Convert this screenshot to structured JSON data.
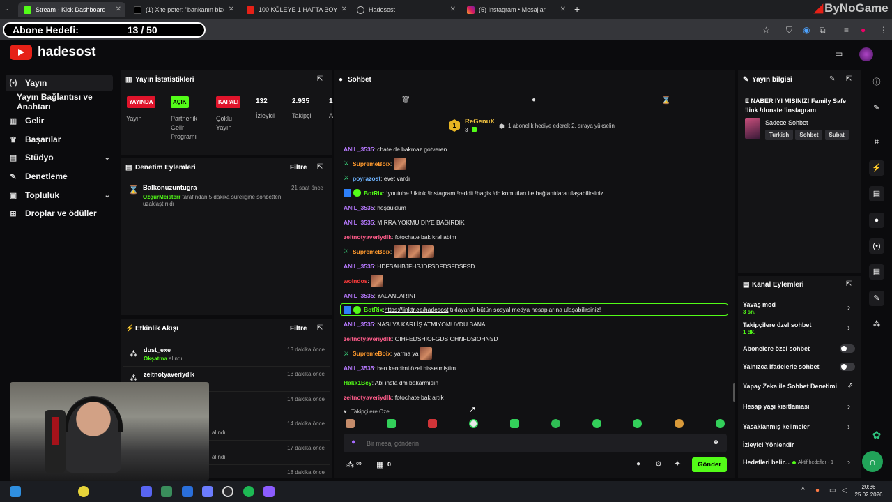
{
  "browser": {
    "tabs": [
      {
        "label": "Stream - Kick Dashboard",
        "active": true
      },
      {
        "label": "(1) X'te peter: \"bankanın bize 5("
      },
      {
        "label": "100 KÖLEYE 1 HAFTA BOYUNCA"
      },
      {
        "label": "Hadesost"
      },
      {
        "label": "(5) Instagram • Mesajlar"
      }
    ],
    "new_tab": "+",
    "watermark": "ByNoGame"
  },
  "overlay": {
    "goal_label": "Abone Hedefi:",
    "goal_value": "13 / 50"
  },
  "header": {
    "brand": "hadesost"
  },
  "sidebar": {
    "items": [
      {
        "label": "Yayın",
        "icon": "broadcast-icon"
      },
      {
        "label": "Yayın Bağlantısı ve Anahtarı"
      },
      {
        "label": "Gelir",
        "icon": "revenue-icon"
      },
      {
        "label": "Başarılar",
        "icon": "trophy-icon"
      },
      {
        "label": "Stüdyo",
        "icon": "studio-icon"
      },
      {
        "label": "Denetleme",
        "icon": "wrench-icon"
      },
      {
        "label": "Topluluk",
        "icon": "community-icon"
      },
      {
        "label": "Droplar ve ödüller",
        "icon": "gift-icon"
      }
    ]
  },
  "stats": {
    "title": "Yayın İstatistikleri",
    "pills": [
      {
        "badge": "YAYINDA",
        "label": "Yayın",
        "color": "#e0142b"
      },
      {
        "badge": "AÇIK",
        "label": "Partnerlik Gelir Programı",
        "color": "#53fc18"
      },
      {
        "badge": "KAPALI",
        "label": "Çoklu Yayın",
        "color": "#e0142b"
      }
    ],
    "viewers": {
      "value": "132",
      "label": "İzleyici"
    },
    "followers": {
      "value": "2.935",
      "label": "Takipçi"
    },
    "extra": {
      "value": "1",
      "label": "A"
    }
  },
  "moderation": {
    "title": "Denetim Eylemleri",
    "filter": "Filtre",
    "entry": {
      "user": "Balkonuzuntugra",
      "time": "21 saat önce",
      "actor": "OzgurMeisterr",
      "text": " tarafından 5 dakika süreliğine sohbetten uzaklaştırıldı"
    }
  },
  "activity": {
    "title": "Etkinlik Akışı",
    "filter": "Filtre",
    "events": [
      {
        "name": "dust_exe",
        "highlight": "Okşatma",
        "sub": " alındı",
        "time": "13 dakika önce"
      },
      {
        "name": "zeitnotyaveriydlk",
        "highlight": "",
        "sub": "",
        "time": "13 dakika önce"
      },
      {
        "name": "",
        "highlight": "",
        "sub": "",
        "time": "14 dakika önce"
      },
      {
        "name": "",
        "highlight": "",
        "sub": "alındı",
        "time": "14 dakika önce"
      },
      {
        "name": "",
        "highlight": "",
        "sub": "alındı",
        "time": "17 dakika önce"
      },
      {
        "name": "",
        "highlight": "",
        "sub": "",
        "time": "18 dakika önce"
      }
    ]
  },
  "chat": {
    "title": "Sohbet",
    "pinned": {
      "user": "ReGenuX",
      "count": "3",
      "text": "1 abonelik hediye ederek 2. sıraya yükselin"
    },
    "messages": [
      {
        "user": "ANIL_3535",
        "color": "#b77aff",
        "text": ": chate de bakmaz gotveren"
      },
      {
        "user": "SupremeBoix",
        "color": "#ff9a2e",
        "text": ":",
        "emotes": 1,
        "badge": "sword"
      },
      {
        "user": "poyrazost",
        "color": "#6fb4ff",
        "text": ": evet vardı",
        "badge": "sword"
      },
      {
        "user": "BotRix",
        "color": "#53fc18",
        "text": ": !youtube !tiktok !instagram !reddit !bagis !dc komutları ile bağlantılara ulaşabilirsiniz",
        "badge": "bot"
      },
      {
        "user": "ANIL_3535",
        "color": "#b77aff",
        "text": ": hoşbuldum"
      },
      {
        "user": "ANIL_3535",
        "color": "#b77aff",
        "text": ": MIRRA YOKMU DİYE BAĞIRDIK"
      },
      {
        "user": "zeitnotyaveriydlk",
        "color": "#ff5c8a",
        "text": ": fotochate bak kral abim"
      },
      {
        "user": "SupremeBoix",
        "color": "#ff9a2e",
        "text": ":",
        "emotes": 3,
        "badge": "sword"
      },
      {
        "user": "ANIL_3535",
        "color": "#b77aff",
        "text": ": HDFSAHBJFHSJDFSDFDSFDSFSD"
      },
      {
        "user": "woindos",
        "color": "#ff3b3b",
        "text": ":",
        "emotes": 1
      },
      {
        "user": "ANIL_3535",
        "color": "#b77aff",
        "text": ": YALANLARINI"
      },
      {
        "user": "BotRix",
        "color": "#53fc18",
        "text": " tıklayarak bütün sosyal medya hesaplarına ulaşabilirsiniz!",
        "link": "https://linktr.ee/hadesost",
        "badge": "bot",
        "highlight": true
      },
      {
        "user": "ANIL_3535",
        "color": "#b77aff",
        "text": ": NASI YA KARI İŞ ATMIYOMUYDU BANA"
      },
      {
        "user": "zeitnotyaveriydlk",
        "color": "#ff5c8a",
        "text": ": OIHFEDSHIOFGDSIOHNFDSIOHNSD"
      },
      {
        "user": "SupremeBoix",
        "color": "#ff9a2e",
        "text": ": yarma ya",
        "emotes": 1,
        "badge": "sword"
      },
      {
        "user": "ANIL_3535",
        "color": "#b77aff",
        "text": ": ben kendimi özel hissetmiştim"
      },
      {
        "user": "Hakk1Bey",
        "color": "#53fc18",
        "text": ": Abi insta dm bakarmısın"
      },
      {
        "user": "zeitnotyaveriydlk",
        "color": "#ff5c8a",
        "text": ": fotochate bak artık"
      }
    ],
    "followers_only": "Takipçilere Özel",
    "input_placeholder": "Bir mesaj gönderin",
    "send_label": "Gönder",
    "gift_count": "0",
    "infinity": "∞"
  },
  "stream_info": {
    "title": "Yayın bilgisi",
    "text": "E NABER İYİ MİSİNİZ! Family Safe !link !donate !instagram",
    "category": "Sadece Sohbet",
    "tags": [
      "Turkish",
      "Sohbet",
      "Subat"
    ]
  },
  "channel_actions": {
    "title": "Kanal Eylemleri",
    "slow_mode": {
      "label": "Yavaş mod",
      "value": "3 sn."
    },
    "followers_chat": {
      "label": "Takipçilere özel sohbet",
      "value": "1 dk."
    },
    "subs_only": {
      "label": "Abonelere özel sohbet",
      "on": false
    },
    "emotes_only": {
      "label": "Yalnızca ifadelerle sohbet",
      "on": false
    },
    "ai_mod": "Yapay Zeka ile Sohbet Denetimi",
    "account_age": "Hesap yaşı kısıtlaması",
    "banned_words": "Yasaklanmış kelimeler",
    "raid": "İzleyici Yönlendir",
    "goals": {
      "label": "Hedefleri belir...",
      "status": "Aktif hedefler - 1"
    }
  },
  "taskbar": {
    "time": "20:36",
    "date": "25.02.2026"
  },
  "colors": {
    "kick_green": "#53fc18",
    "panel": "#141416",
    "live_red": "#e0142b"
  }
}
